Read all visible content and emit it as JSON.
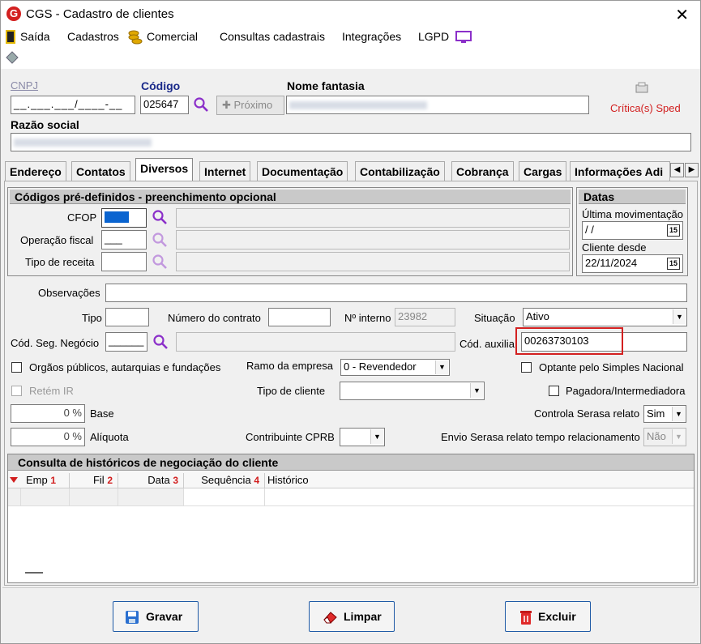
{
  "window": {
    "title": "CGS - Cadastro de clientes",
    "close": "✕"
  },
  "menu": {
    "exit": "Saída",
    "cadastros": "Cadastros",
    "comercial": "Comercial",
    "consultas": "Consultas cadastrais",
    "integracoes": "Integrações",
    "lgpd": "LGPD"
  },
  "header": {
    "cnpj_label": "CNPJ",
    "cnpj_value": "__.___.___/____-__",
    "codigo_label": "Código",
    "codigo_value": "025647",
    "proximo_label": "Próximo",
    "nome_fantasia_label": "Nome fantasia",
    "razao_social_label": "Razão social",
    "criticas_label": "Crítica(s) Sped"
  },
  "tabs": [
    "Endereço",
    "Contatos",
    "Diversos",
    "Internet",
    "Documentação",
    "Contabilização",
    "Cobrança",
    "Cargas",
    "Informações Adi"
  ],
  "active_tab": "Diversos",
  "codigos": {
    "title": "Códigos pré-definidos - preenchimento opcional",
    "cfop_label": "CFOP",
    "operacao_label": "Operação fiscal",
    "operacao_value": "___",
    "tipo_receita_label": "Tipo de receita"
  },
  "datas": {
    "title": "Datas",
    "ultima_label": "Última movimentação",
    "ultima_value": "  /  /",
    "cliente_desde_label": "Cliente desde",
    "cliente_desde_value": "22/11/2024",
    "cal_icon": "15"
  },
  "form": {
    "observacoes_label": "Observações",
    "tipo_label": "Tipo",
    "contrato_label": "Número do contrato",
    "interno_label": "Nº interno",
    "interno_value": "23982",
    "situacao_label": "Situação",
    "situacao_value": "Ativo",
    "seg_negocio_label": "Cód. Seg. Negócio",
    "seg_negocio_value": "______",
    "cod_auxiliar_label": "Cód. auxilia",
    "cod_auxiliar_value": "00263730103",
    "orgaos_label": "Orgãos públicos, autarquias e fundações",
    "ramo_label": "Ramo da empresa",
    "ramo_value": "0 - Revendedor",
    "simples_label": "Optante pelo Simples Nacional",
    "retem_label": "Retém IR",
    "tipo_cliente_label": "Tipo de cliente",
    "pagadora_label": "Pagadora/Intermediadora",
    "base_label": "Base",
    "base_value": "0 %",
    "serasa_label": "Controla Serasa relato",
    "serasa_value": "Sim",
    "aliquota_label": "Alíquota",
    "aliquota_value": "0 %",
    "cprb_label": "Contribuinte CPRB",
    "envio_label": "Envio Serasa relato tempo relacionamento",
    "envio_value": "Não"
  },
  "historico": {
    "title": "Consulta de históricos de negociação do cliente",
    "columns": [
      {
        "label": "Emp",
        "num": "1"
      },
      {
        "label": "Fil",
        "num": "2"
      },
      {
        "label": "Data",
        "num": "3"
      },
      {
        "label": "Sequência",
        "num": "4"
      },
      {
        "label": "Histórico",
        "num": ""
      }
    ]
  },
  "buttons": {
    "gravar": "Gravar",
    "limpar": "Limpar",
    "excluir": "Excluir"
  },
  "colors": {
    "accent_purple": "#8b2fc9",
    "red": "#d21e1e",
    "highlight_border": "#d32020",
    "blue_btn": "#1f5aa6"
  }
}
